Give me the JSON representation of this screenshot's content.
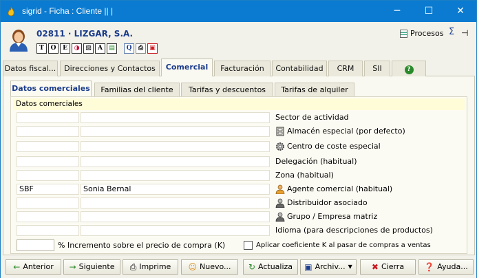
{
  "window": {
    "title": "sigrid - Ficha : Cliente || |",
    "min_glyph": "─",
    "max_glyph": "☐",
    "close_glyph": "✕"
  },
  "header": {
    "client_title": "02811 · LIZGAR, S.A.",
    "procesos_label": "Procesos",
    "sigma_glyph": "Σ",
    "pin_glyph": "⊣",
    "tool_icons": [
      "T",
      "O",
      "E",
      "◑",
      "▨",
      "A",
      "▤",
      "Q",
      "⎙",
      "▣"
    ]
  },
  "main_tabs": [
    {
      "label": "Datos fiscal..."
    },
    {
      "label": "Direcciones y Contactos"
    },
    {
      "label": "Comercial"
    },
    {
      "label": "Facturación"
    },
    {
      "label": "Contabilidad"
    },
    {
      "label": "CRM"
    },
    {
      "label": "SII"
    },
    {
      "label": "?"
    }
  ],
  "sub_tabs": [
    {
      "label": "Datos comerciales"
    },
    {
      "label": "Familias del cliente"
    },
    {
      "label": "Tarifas y descuentos"
    },
    {
      "label": "Tarifas de alquiler"
    }
  ],
  "section": {
    "title": "Datos comerciales"
  },
  "fields": [
    {
      "code": "",
      "name": "",
      "label": "Sector de actividad"
    },
    {
      "code": "",
      "name": "",
      "label": "Almacén especial (por defecto)"
    },
    {
      "code": "",
      "name": "",
      "label": "Centro de coste especial"
    },
    {
      "code": "",
      "name": "",
      "label": "Delegación (habitual)"
    },
    {
      "code": "",
      "name": "",
      "label": "Zona (habitual)"
    },
    {
      "code": "SBF",
      "name": "Sonia Bernal",
      "label": "Agente comercial (habitual)"
    },
    {
      "code": "",
      "name": "",
      "label": "Distribuidor asociado"
    },
    {
      "code": "",
      "name": "",
      "label": "Grupo / Empresa matriz"
    },
    {
      "code": "",
      "name": "",
      "label": "Idioma (para descripciones de productos)"
    }
  ],
  "k_increment": {
    "value": "",
    "label": "% Incremento sobre el precio de compra (K)",
    "checkbox_label": "Aplicar coeficiente K al pasar de compras a ventas",
    "checked": false
  },
  "footer": {
    "anterior": "Anterior",
    "siguiente": "Siguiente",
    "imprime": "Imprime",
    "nuevo": "Nuevo...",
    "actualiza": "Actualiza",
    "archivo": "Archiv...",
    "cierra": "Cierra",
    "ayuda": "Ayuda..."
  },
  "colors": {
    "titlebar": "#0a7bd0",
    "accent_text": "#1b3c8c",
    "section_head": "#fffcd8"
  }
}
